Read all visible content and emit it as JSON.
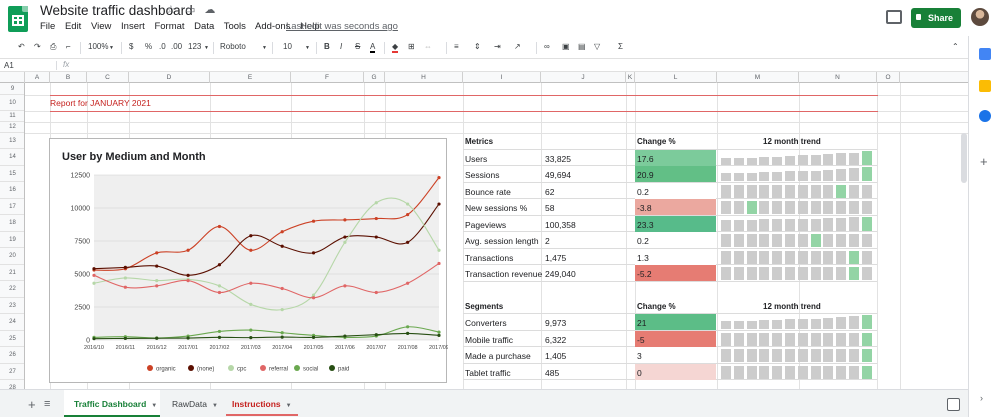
{
  "app": {
    "title": "Website traffic dashboard",
    "title_icons": [
      "star-icon",
      "folder-icon",
      "cloud-icon"
    ],
    "menu": [
      "File",
      "Edit",
      "View",
      "Insert",
      "Format",
      "Data",
      "Tools",
      "Add-ons",
      "Help"
    ],
    "last_edit": "Last edit was seconds ago",
    "share_label": "Share"
  },
  "toolbar": {
    "zoom": "100%",
    "currency": "$",
    "percent": "%",
    "decimal_less": ".0",
    "decimal_more": ".00",
    "more_formats": "123",
    "font": "Roboto",
    "font_size": "10",
    "bold": "B",
    "italic": "I",
    "strike": "S",
    "text_color": "A"
  },
  "formula_bar": {
    "cell": "A1",
    "fx": "fx",
    "value": ""
  },
  "columns": [
    "A",
    "B",
    "C",
    "D",
    "E",
    "F",
    "G",
    "H",
    "I",
    "J",
    "K",
    "L",
    "M",
    "N",
    "O"
  ],
  "rows": [
    "9",
    "10",
    "11",
    "12",
    "13",
    "14",
    "15",
    "16",
    "17",
    "18",
    "19",
    "20",
    "21",
    "22",
    "23",
    "24",
    "25",
    "26",
    "27",
    "28"
  ],
  "report_title": "Report for JANUARY 2021",
  "chart_data": {
    "type": "line",
    "title": "User by Medium and Month",
    "categories": [
      "2016/10",
      "2016/11",
      "2016/12",
      "2017/01",
      "2017/02",
      "2017/03",
      "2017/04",
      "2017/05",
      "2017/06",
      "2017/07",
      "2017/08",
      "2017/09"
    ],
    "y_ticks": [
      "12500",
      "10000",
      "7500",
      "5000",
      "2500",
      "0"
    ],
    "ylim": [
      0,
      12500
    ],
    "legend_position": "bottom",
    "series": [
      {
        "name": "organic",
        "color": "#cc4125",
        "values": [
          5300,
          5400,
          6600,
          6800,
          8600,
          6800,
          8200,
          9000,
          9100,
          9200,
          9500,
          12300
        ]
      },
      {
        "name": "(none)",
        "color": "#5b0f00",
        "values": [
          5400,
          5500,
          5600,
          4900,
          5700,
          7900,
          7100,
          6600,
          7800,
          7800,
          7400,
          10300
        ]
      },
      {
        "name": "cpc",
        "color": "#b6d7a8",
        "values": [
          4300,
          4700,
          4500,
          4600,
          4100,
          2700,
          2300,
          3400,
          7400,
          10400,
          10300,
          6800
        ]
      },
      {
        "name": "referral",
        "color": "#e06666",
        "values": [
          4900,
          4000,
          4100,
          4500,
          3600,
          4300,
          3900,
          3200,
          4100,
          3600,
          4300,
          5800
        ]
      },
      {
        "name": "social",
        "color": "#6aa84f",
        "values": [
          200,
          250,
          150,
          300,
          650,
          750,
          550,
          350,
          200,
          300,
          1000,
          600
        ]
      },
      {
        "name": "paid",
        "color": "#274e13",
        "values": [
          100,
          120,
          130,
          150,
          200,
          180,
          220,
          200,
          300,
          400,
          500,
          350
        ]
      }
    ]
  },
  "metrics": {
    "header": "Metrics",
    "change_header": "Change %",
    "trend_header": "12 month trend",
    "rows": [
      {
        "name": "Users",
        "value": "33,825",
        "change": "17.6",
        "change_bg": "#7ccb9b",
        "trend": [
          0.5,
          0.5,
          0.5,
          0.55,
          0.55,
          0.6,
          0.65,
          0.7,
          0.75,
          0.8,
          0.85,
          1.0
        ],
        "trend_hi": 11
      },
      {
        "name": "Sessions",
        "value": "49,694",
        "change": "20.9",
        "change_bg": "#62bf86",
        "trend": [
          0.6,
          0.6,
          0.6,
          0.65,
          0.65,
          0.7,
          0.7,
          0.75,
          0.8,
          0.85,
          0.9,
          1.0
        ],
        "trend_hi": 11
      },
      {
        "name": "Bounce rate",
        "value": "62",
        "change": "0.2",
        "change_bg": "#fff",
        "trend": [
          0.9,
          0.9,
          0.9,
          0.9,
          0.9,
          0.9,
          0.9,
          0.9,
          0.9,
          0.9,
          0.9,
          0.9
        ],
        "trend_hi": 9
      },
      {
        "name": "New sessions %",
        "value": "58",
        "change": "-3.8",
        "change_bg": "#eba89f",
        "trend": [
          0.9,
          0.9,
          0.9,
          0.9,
          0.9,
          0.9,
          0.9,
          0.9,
          0.9,
          0.9,
          0.9,
          0.9
        ],
        "trend_hi": 2
      },
      {
        "name": "Pageviews",
        "value": "100,358",
        "change": "23.3",
        "change_bg": "#57bb8a",
        "trend": [
          0.75,
          0.75,
          0.75,
          0.8,
          0.8,
          0.8,
          0.85,
          0.85,
          0.9,
          0.9,
          0.95,
          1.0
        ],
        "trend_hi": 11
      },
      {
        "name": "Avg. session length",
        "value": "2",
        "change": "0.2",
        "change_bg": "#fff",
        "trend": [
          0.9,
          0.9,
          0.9,
          0.9,
          0.9,
          0.9,
          0.9,
          0.9,
          0.9,
          0.9,
          0.9,
          0.9
        ],
        "trend_hi": 7
      },
      {
        "name": "Transactions",
        "value": "1,475",
        "change": "1.3",
        "change_bg": "#fff",
        "trend": [
          0.9,
          0.9,
          0.9,
          0.9,
          0.9,
          0.9,
          0.9,
          0.9,
          0.9,
          0.9,
          0.9,
          0.9
        ],
        "trend_hi": 10
      },
      {
        "name": "Transaction revenue",
        "value": "249,040",
        "change": "-5.2",
        "change_bg": "#e67c73",
        "trend": [
          0.9,
          0.9,
          0.9,
          0.9,
          0.9,
          0.9,
          0.9,
          0.9,
          0.9,
          0.9,
          0.9,
          0.9
        ],
        "trend_hi": 10
      }
    ]
  },
  "segments": {
    "header": "Segments",
    "change_header": "Change %",
    "trend_header": "12 month trend",
    "rows": [
      {
        "name": "Converters",
        "value": "9,973",
        "change": "21",
        "change_bg": "#5cbd87",
        "trend": [
          0.6,
          0.6,
          0.6,
          0.65,
          0.65,
          0.7,
          0.7,
          0.75,
          0.8,
          0.85,
          0.9,
          1.0
        ],
        "trend_hi": 11
      },
      {
        "name": "Mobile traffic",
        "value": "6,322",
        "change": "-5",
        "change_bg": "#e67c73",
        "trend": [
          0.9,
          0.9,
          0.9,
          0.9,
          0.9,
          0.9,
          0.9,
          0.9,
          0.9,
          0.9,
          0.9,
          0.9
        ],
        "trend_hi": 11
      },
      {
        "name": "Made a purchase",
        "value": "1,405",
        "change": "3",
        "change_bg": "#fff",
        "trend": [
          0.9,
          0.9,
          0.9,
          0.9,
          0.9,
          0.9,
          0.9,
          0.9,
          0.9,
          0.9,
          0.9,
          0.9
        ],
        "trend_hi": 11
      },
      {
        "name": "Tablet traffic",
        "value": "485",
        "change": "0",
        "change_bg": "#f5d6d3",
        "trend": [
          0.9,
          0.9,
          0.9,
          0.9,
          0.9,
          0.9,
          0.9,
          0.9,
          0.9,
          0.9,
          0.9,
          0.9
        ],
        "trend_hi": 11
      }
    ]
  },
  "tabs": [
    {
      "label": "Traffic Dashboard",
      "active": true
    },
    {
      "label": "RawData",
      "active": false
    },
    {
      "label": "Instructions",
      "active": false
    }
  ],
  "colors": {
    "trend_bar": "#cccccc",
    "trend_bar_hi": "#93d4a5",
    "accent_green": "#188038",
    "report_red": "#c5221f"
  }
}
